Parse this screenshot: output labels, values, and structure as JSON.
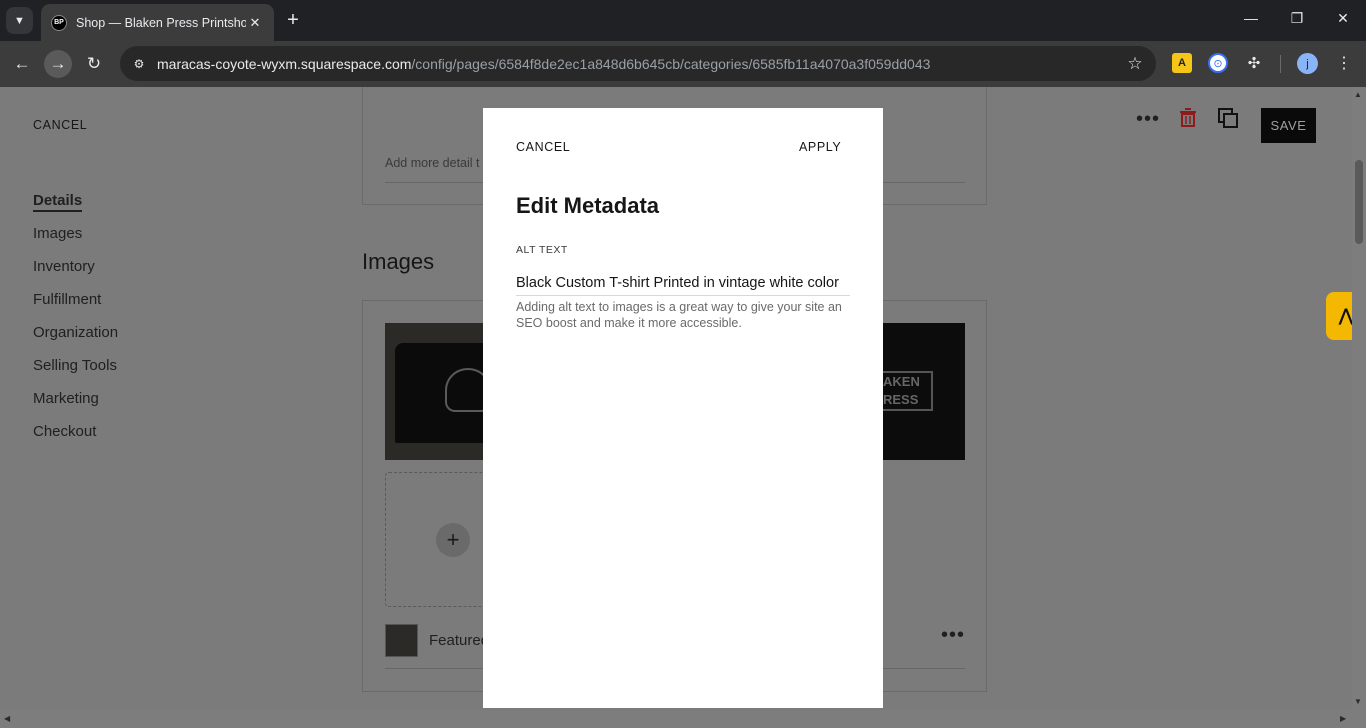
{
  "browser": {
    "tab_title": "Shop — Blaken Press Printshop",
    "favicon_text": "BP",
    "url_host": "maracas-coyote-wyxm.squarespace.com",
    "url_path": "/config/pages/6584f8de2ec1a848d6b645cb/categories/6585fb11a4070a3f059dd043",
    "profile_initial": "j"
  },
  "page": {
    "cancel_label": "CANCEL",
    "save_label": "SAVE",
    "nav": [
      {
        "label": "Details",
        "active": true
      },
      {
        "label": "Images"
      },
      {
        "label": "Inventory"
      },
      {
        "label": "Fulfillment"
      },
      {
        "label": "Organization"
      },
      {
        "label": "Selling Tools"
      },
      {
        "label": "Marketing"
      },
      {
        "label": "Checkout"
      }
    ],
    "top_card_hint": "Add more detail t",
    "images_heading": "Images",
    "right_thumb_text": "AKEN\nRESS",
    "featured_label": "Featured"
  },
  "modal": {
    "cancel_label": "CANCEL",
    "apply_label": "APPLY",
    "title": "Edit Metadata",
    "alt_text_label": "ALT TEXT",
    "alt_text_value": "Black Custom T-shirt Printed in vintage white color",
    "help_text": "Adding alt text to images is a great way to give your site an SEO boost and make it more accessible."
  },
  "icons": {
    "tab_search": "chevron-down-icon",
    "close": "close-icon",
    "new_tab": "plus-icon",
    "back": "arrow-left-icon",
    "forward": "arrow-right-icon",
    "reload": "reload-icon",
    "site_settings": "tune-icon",
    "bookmark": "star-icon",
    "extensions": "puzzle-icon",
    "more": "more-vertical-icon",
    "trash": "trash-icon",
    "duplicate": "duplicate-icon"
  },
  "colors": {
    "save_bg": "#0a0a0a",
    "trash": "#8c1c1c",
    "widget": "#f5b800"
  }
}
